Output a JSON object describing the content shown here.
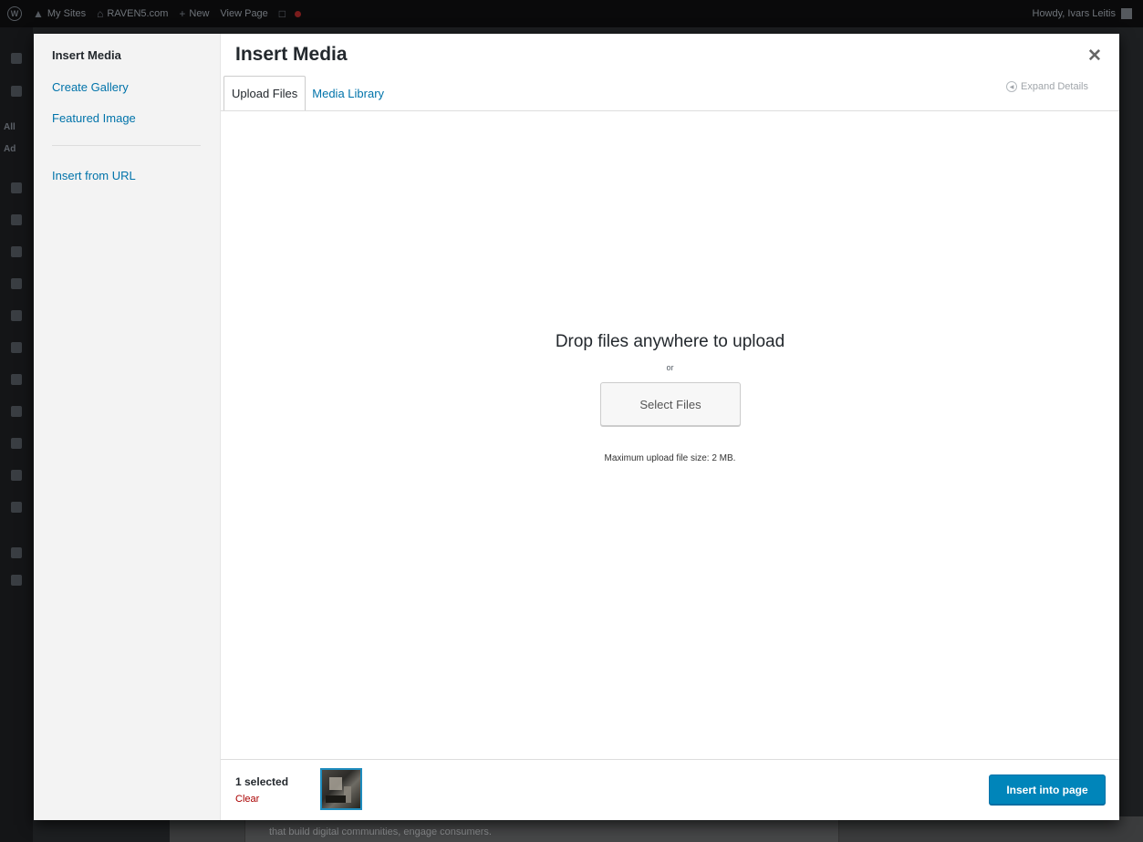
{
  "admin_bar": {
    "my_sites": "My Sites",
    "site_name": "RAVEN5.com",
    "new": "New",
    "view_page": "View Page",
    "howdy": "Howdy, Ivars Leitis"
  },
  "admin_menu": {
    "all_label": "All",
    "add_label": "Ad"
  },
  "modal": {
    "title": "Insert Media",
    "close_icon": "close-icon",
    "menu": {
      "items": [
        {
          "label": "Insert Media"
        },
        {
          "label": "Create Gallery"
        },
        {
          "label": "Featured Image"
        },
        {
          "label": "Insert from URL"
        }
      ]
    },
    "tabs": [
      {
        "label": "Upload Files"
      },
      {
        "label": "Media Library"
      }
    ],
    "expand_details": "Expand Details",
    "uploader": {
      "drop_title": "Drop files anywhere to upload",
      "or": "or",
      "select_files": "Select Files",
      "max_size": "Maximum upload file size: 2 MB."
    },
    "toolbar": {
      "selection_count": "1 selected",
      "clear": "Clear",
      "insert_button": "Insert into page"
    }
  },
  "background_page": {
    "text": "that build digital communities, engage consumers."
  },
  "colors": {
    "link": "#0073aa",
    "primary_button": "#0085ba",
    "clear_link": "#aa0000",
    "selected_thumb_border": "#1e8cbe"
  }
}
